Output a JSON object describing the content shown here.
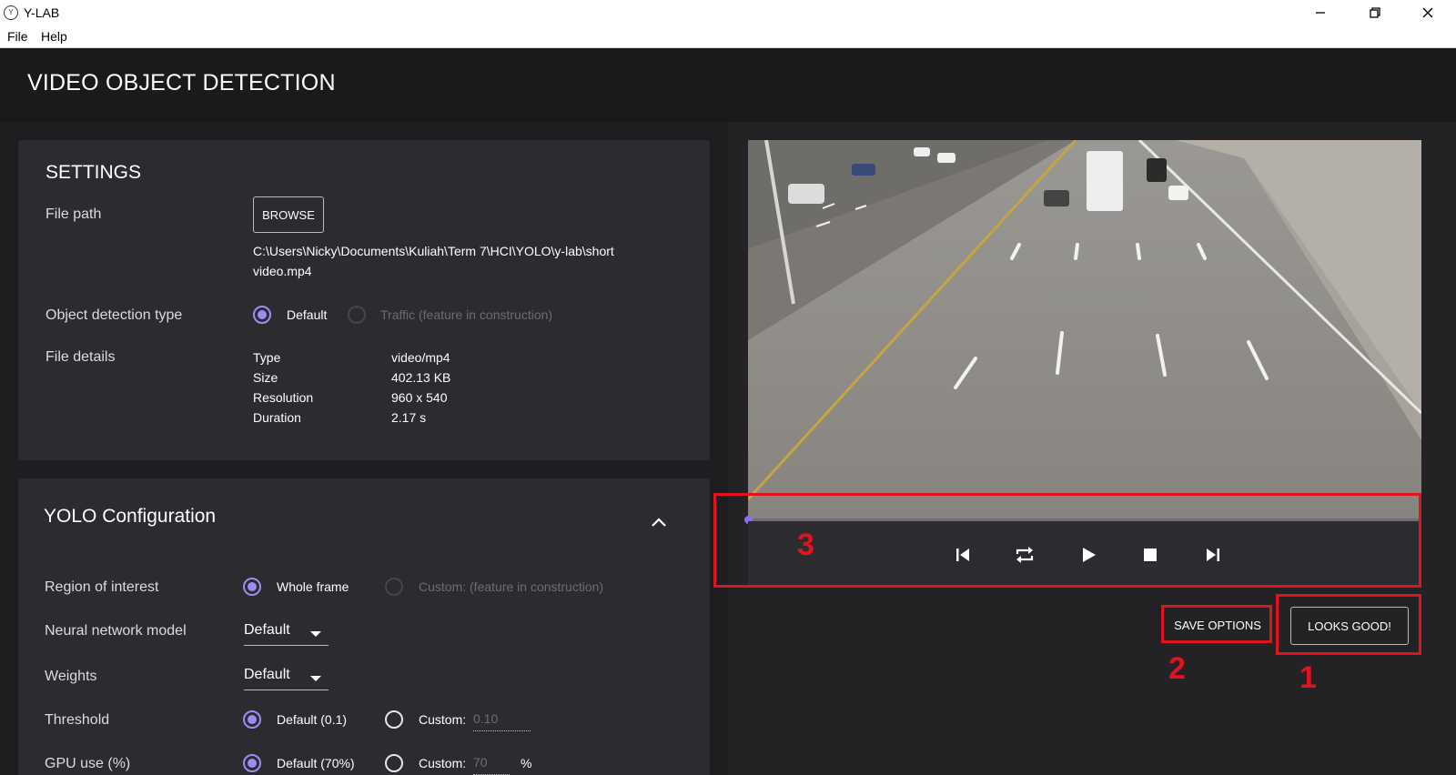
{
  "window": {
    "title": "Y-LAB",
    "app_icon": "ylab-logo-icon"
  },
  "menu": {
    "file": "File",
    "help": "Help"
  },
  "header": {
    "title": "VIDEO OBJECT DETECTION"
  },
  "settings": {
    "title": "SETTINGS",
    "file_path_label": "File path",
    "browse_label": "BROWSE",
    "file_path_line1": "C:\\Users\\Nicky\\Documents\\Kuliah\\Term 7\\HCI\\YOLO\\y-lab\\short",
    "file_path_line2": "video.mp4",
    "detection_type_label": "Object detection type",
    "detection_default": "Default",
    "detection_traffic": "Traffic (feature in construction)",
    "file_details_label": "File details",
    "details": {
      "type_label": "Type",
      "type_value": "video/mp4",
      "size_label": "Size",
      "size_value": "402.13 KB",
      "resolution_label": "Resolution",
      "resolution_value": "960 x 540",
      "duration_label": "Duration",
      "duration_value": "2.17 s"
    }
  },
  "yolo": {
    "title": "YOLO Configuration",
    "roi_label": "Region of interest",
    "roi_whole": "Whole frame",
    "roi_custom": "Custom: (feature in construction)",
    "model_label": "Neural network model",
    "model_value": "Default",
    "weights_label": "Weights",
    "weights_value": "Default",
    "threshold_label": "Threshold",
    "threshold_default": "Default (0.1)",
    "threshold_custom": "Custom:",
    "threshold_custom_value": "0.10",
    "gpu_label": "GPU use (%)",
    "gpu_default": "Default (70%)",
    "gpu_custom": "Custom:",
    "gpu_custom_value": "70",
    "gpu_unit": "%"
  },
  "player": {
    "progress": 0.0
  },
  "buttons": {
    "save_options": "SAVE OPTIONS",
    "looks_good": "LOOKS GOOD!"
  },
  "annotations": {
    "one": "1",
    "two": "2",
    "three": "3"
  },
  "colors": {
    "accent": "#9e8cf5",
    "annotation": "#e0141e",
    "card": "#2c2c30"
  }
}
